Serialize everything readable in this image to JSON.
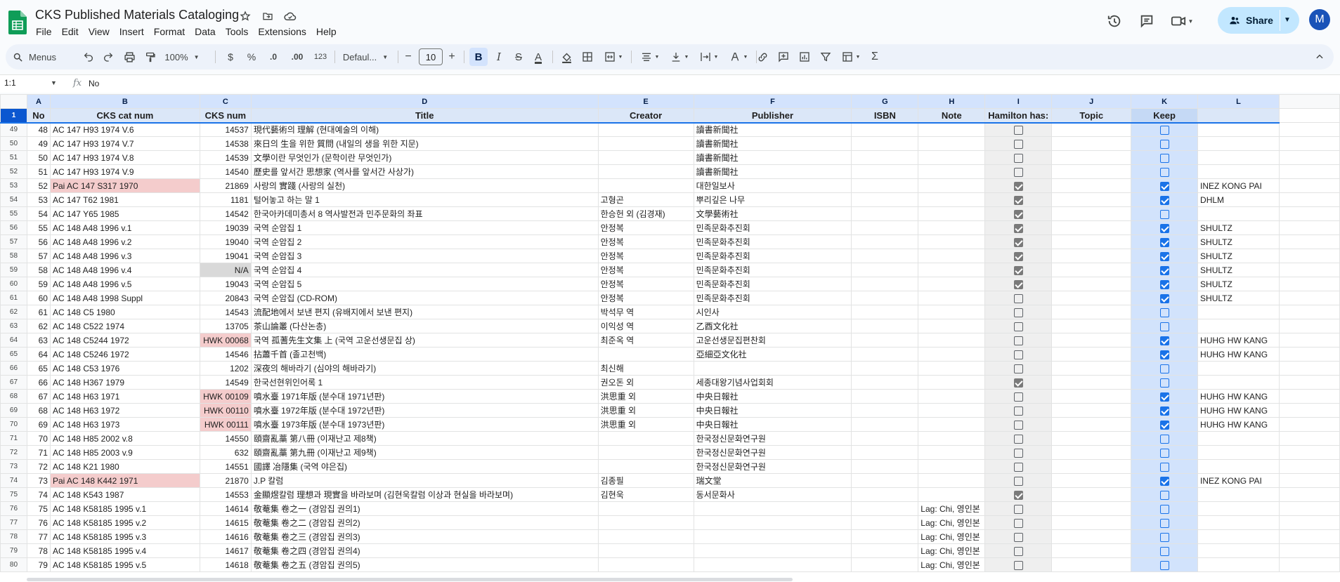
{
  "app": {
    "title": "CKS Published Materials Cataloging",
    "menus": [
      "File",
      "Edit",
      "View",
      "Insert",
      "Format",
      "Data",
      "Tools",
      "Extensions",
      "Help"
    ],
    "share_label": "Share",
    "avatar_letter": "M",
    "brand_color": "#0f9d58"
  },
  "toolbar": {
    "menus_label": "Menus",
    "zoom": "100%",
    "currency": "$",
    "percent": "%",
    "dec_less": ".0",
    "dec_more": ".00",
    "number_format": "123",
    "font": "Defaul...",
    "font_size": "10",
    "minus": "−",
    "plus": "+",
    "bold": "B",
    "italic": "I",
    "strike": "S",
    "textcolor": "A",
    "sum": "Σ"
  },
  "formula_bar": {
    "cell_ref": "1:1",
    "fx": "fx",
    "value": "No"
  },
  "columns": [
    "A",
    "B",
    "C",
    "D",
    "E",
    "F",
    "G",
    "H",
    "I",
    "J",
    "K",
    "L"
  ],
  "header_row": {
    "row_number": "1",
    "cells": [
      "No",
      "CKS cat num",
      "CKS num",
      "Title",
      "Creator",
      "Publisher",
      "ISBN",
      "Note",
      "Hamilton has:",
      "Topic",
      "Keep",
      ""
    ]
  },
  "rows": [
    {
      "r": "49",
      "no": "48",
      "cat": "AC 147 H93 1974 V.6",
      "num": "14537",
      "title": "現代藝術의 理解 (현대예술의 이해)",
      "creator": "",
      "publisher": "讀書新聞社",
      "note": "",
      "ham": false,
      "keep": false,
      "l": ""
    },
    {
      "r": "50",
      "no": "49",
      "cat": "AC 147 H93 1974 V.7",
      "num": "14538",
      "title": "來日의 生을 위한 質問 (내일의 생을 위한 지문)",
      "creator": "",
      "publisher": "讀書新聞社",
      "note": "",
      "ham": false,
      "keep": false,
      "l": ""
    },
    {
      "r": "51",
      "no": "50",
      "cat": "AC 147 H93 1974 V.8",
      "num": "14539",
      "title": "文學이란 무엇인가 (문학이란 무엇인가)",
      "creator": "",
      "publisher": "讀書新聞社",
      "note": "",
      "ham": false,
      "keep": false,
      "l": ""
    },
    {
      "r": "52",
      "no": "51",
      "cat": "AC 147 H93 1974 V.9",
      "num": "14540",
      "title": "歷史를 앞서간 思想家 (역사를 앞서간 사상가)",
      "creator": "",
      "publisher": "讀書新聞社",
      "note": "",
      "ham": false,
      "keep": false,
      "l": ""
    },
    {
      "r": "53",
      "no": "52",
      "cat": "Pai AC 147 S317 1970",
      "num": "21869",
      "title": "사랑의 實踐 (사랑의 실천)",
      "creator": "",
      "publisher": "대한일보사",
      "note": "",
      "ham": true,
      "keep": true,
      "l": "INEZ KONG PAI",
      "catHl": "pink"
    },
    {
      "r": "54",
      "no": "53",
      "cat": "AC 147 T62 1981",
      "num": "1181",
      "title": "털어놓고 하는 말 1",
      "creator": "고형곤",
      "publisher": "뿌리깊은 나무",
      "note": "",
      "ham": true,
      "keep": true,
      "l": "DHLM"
    },
    {
      "r": "55",
      "no": "54",
      "cat": "AC 147 Y65 1985",
      "num": "14542",
      "title": "한국아카데미총서 8 역사발전과 민주문화의 좌표",
      "creator": "한승헌 외 (김경재)",
      "publisher": "文學藝術社",
      "note": "",
      "ham": true,
      "keep": false,
      "l": ""
    },
    {
      "r": "56",
      "no": "55",
      "cat": "AC 148 A48 1996 v.1",
      "num": "19039",
      "title": "국역 순암집 1",
      "creator": "안정복",
      "publisher": "민족문화추진회",
      "note": "",
      "ham": true,
      "keep": true,
      "l": "SHULTZ"
    },
    {
      "r": "57",
      "no": "56",
      "cat": "AC 148 A48 1996 v.2",
      "num": "19040",
      "title": "국역 순암집 2",
      "creator": "안정복",
      "publisher": "민족문화추진회",
      "note": "",
      "ham": true,
      "keep": true,
      "l": "SHULTZ"
    },
    {
      "r": "58",
      "no": "57",
      "cat": "AC 148 A48 1996 v.3",
      "num": "19041",
      "title": "국역 순암집 3",
      "creator": "안정복",
      "publisher": "민족문화추진회",
      "note": "",
      "ham": true,
      "keep": true,
      "l": "SHULTZ"
    },
    {
      "r": "59",
      "no": "58",
      "cat": "AC 148 A48 1996 v.4",
      "num": "N/A",
      "title": "국역 순암집 4",
      "creator": "안정복",
      "publisher": "민족문화추진회",
      "note": "",
      "ham": true,
      "keep": true,
      "l": "SHULTZ",
      "numHl": "gray"
    },
    {
      "r": "60",
      "no": "59",
      "cat": "AC 148 A48 1996 v.5",
      "num": "19043",
      "title": "국역 순암집 5",
      "creator": "안정복",
      "publisher": "민족문화추진회",
      "note": "",
      "ham": true,
      "keep": true,
      "l": "SHULTZ"
    },
    {
      "r": "61",
      "no": "60",
      "cat": "AC 148 A48 1998 Suppl",
      "num": "20843",
      "title": "국역 순암집 (CD-ROM)",
      "creator": "안정복",
      "publisher": "민족문화추진회",
      "note": "",
      "ham": false,
      "keep": true,
      "l": "SHULTZ"
    },
    {
      "r": "62",
      "no": "61",
      "cat": "AC 148 C5 1980",
      "num": "14543",
      "title": "流配地에서 보낸 편지 (유배지에서 보낸 편지)",
      "creator": "박석무 역",
      "publisher": "시인사",
      "note": "",
      "ham": false,
      "keep": false,
      "l": ""
    },
    {
      "r": "63",
      "no": "62",
      "cat": "AC 148 C522 1974",
      "num": "13705",
      "title": "茶山論叢 (다산논총)",
      "creator": "이익성 역",
      "publisher": "乙酉文化社",
      "note": "",
      "ham": false,
      "keep": false,
      "l": ""
    },
    {
      "r": "64",
      "no": "63",
      "cat": "AC 148 C5244 1972",
      "num": "HWK 00068",
      "title": "국역 孤蓍先生文集 上 (국역 고운선생문집 상)",
      "creator": "최준옥 역",
      "publisher": "고운선생문집편찬회",
      "note": "",
      "ham": false,
      "keep": true,
      "l": "HUHG HW KANG",
      "numHl": "pink"
    },
    {
      "r": "65",
      "no": "64",
      "cat": "AC 148 C5246 1972",
      "num": "14546",
      "title": "拈蕭千首 (졸고천백)",
      "creator": "",
      "publisher": "亞細亞文化社",
      "note": "",
      "ham": false,
      "keep": true,
      "l": "HUHG HW KANG"
    },
    {
      "r": "66",
      "no": "65",
      "cat": "AC 148 C53 1976",
      "num": "1202",
      "title": "深夜의 해바라기 (심야의 해바라기)",
      "creator": "최신해",
      "publisher": "",
      "note": "",
      "ham": false,
      "keep": false,
      "l": ""
    },
    {
      "r": "67",
      "no": "66",
      "cat": "AC 148 H367 1979",
      "num": "14549",
      "title": "한국선현위인어록 1",
      "creator": "권오돈 외",
      "publisher": "세종대왕기념사업회회",
      "note": "",
      "ham": true,
      "keep": false,
      "l": ""
    },
    {
      "r": "68",
      "no": "67",
      "cat": "AC 148 H63 1971",
      "num": "HWK 00109",
      "title": "噴水臺 1971年版 (분수대 1971년판)",
      "creator": "洪思重 외",
      "publisher": "中央日報社",
      "note": "",
      "ham": false,
      "keep": true,
      "l": "HUHG HW KANG",
      "numHl": "pink"
    },
    {
      "r": "69",
      "no": "68",
      "cat": "AC 148 H63 1972",
      "num": "HWK 00110",
      "title": "噴水臺 1972年版 (분수대 1972년판)",
      "creator": "洪思重 외",
      "publisher": "中央日報社",
      "note": "",
      "ham": false,
      "keep": true,
      "l": "HUHG HW KANG",
      "numHl": "pink"
    },
    {
      "r": "70",
      "no": "69",
      "cat": "AC 148 H63 1973",
      "num": "HWK 00111",
      "title": "噴水臺 1973年版 (분수대 1973년판)",
      "creator": "洪思重 외",
      "publisher": "中央日報社",
      "note": "",
      "ham": false,
      "keep": true,
      "l": "HUHG HW KANG",
      "numHl": "pink"
    },
    {
      "r": "71",
      "no": "70",
      "cat": "AC 148 H85 2002 v.8",
      "num": "14550",
      "title": "頤齋亂藁 第八冊 (이재난고 제8책)",
      "creator": "",
      "publisher": "한국정신문화연구원",
      "note": "",
      "ham": false,
      "keep": false,
      "l": ""
    },
    {
      "r": "72",
      "no": "71",
      "cat": "AC 148 H85 2003 v.9",
      "num": "632",
      "title": "頤齋亂藁 第九冊 (이재난고 제9책)",
      "creator": "",
      "publisher": "한국정신문화연구원",
      "note": "",
      "ham": false,
      "keep": false,
      "l": ""
    },
    {
      "r": "73",
      "no": "72",
      "cat": "AC 148 K21 1980",
      "num": "14551",
      "title": "國譯 冶隱集 (국역 야은집)",
      "creator": "",
      "publisher": "한국정신문화연구원",
      "note": "",
      "ham": false,
      "keep": false,
      "l": ""
    },
    {
      "r": "74",
      "no": "73",
      "cat": "Pai AC 148 K442 1971",
      "num": "21870",
      "title": "J.P 칼럼",
      "creator": "김종필",
      "publisher": "瑞文堂",
      "note": "",
      "ham": false,
      "keep": true,
      "l": "INEZ KONG PAI",
      "catHl": "pink"
    },
    {
      "r": "75",
      "no": "74",
      "cat": "AC 148 K543 1987",
      "num": "14553",
      "title": "金顯煜칼럼 理想과 現實을 바라보며 (김현욱칼럼 이상과 현실을 바라보며)",
      "creator": "김현욱",
      "publisher": "동서문화사",
      "note": "",
      "ham": true,
      "keep": false,
      "l": ""
    },
    {
      "r": "76",
      "no": "75",
      "cat": "AC 148 K58185 1995 v.1",
      "num": "14614",
      "title": "敬菴集 卷之一 (경암집 권의1)",
      "creator": "",
      "publisher": "",
      "note": "Lag: Chi, 영인본",
      "ham": false,
      "keep": false,
      "l": ""
    },
    {
      "r": "77",
      "no": "76",
      "cat": "AC 148 K58185 1995 v.2",
      "num": "14615",
      "title": "敬菴集 卷之二 (경암집 권의2)",
      "creator": "",
      "publisher": "",
      "note": "Lag: Chi, 영인본",
      "ham": false,
      "keep": false,
      "l": ""
    },
    {
      "r": "78",
      "no": "77",
      "cat": "AC 148 K58185 1995 v.3",
      "num": "14616",
      "title": "敬菴集 卷之三 (경암집 권의3)",
      "creator": "",
      "publisher": "",
      "note": "Lag: Chi, 영인본",
      "ham": false,
      "keep": false,
      "l": ""
    },
    {
      "r": "79",
      "no": "78",
      "cat": "AC 148 K58185 1995 v.4",
      "num": "14617",
      "title": "敬菴集 卷之四 (경암집 권의4)",
      "creator": "",
      "publisher": "",
      "note": "Lag: Chi, 영인본",
      "ham": false,
      "keep": false,
      "l": ""
    },
    {
      "r": "80",
      "no": "79",
      "cat": "AC 148 K58185 1995 v.5",
      "num": "14618",
      "title": "敬菴集 卷之五 (경암집 권의5)",
      "creator": "",
      "publisher": "",
      "note": "Lag: Chi, 영인본",
      "ham": false,
      "keep": false,
      "l": ""
    }
  ]
}
